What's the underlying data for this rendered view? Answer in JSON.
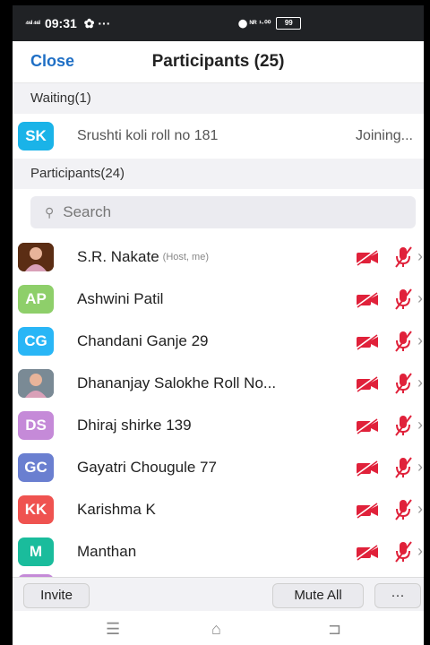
{
  "status_bar": {
    "signal": "⁴⁶ᴵ ⁴⁶ᴵ",
    "time": "09:31",
    "icons": "✿ ···",
    "right_icons": "⬤ ᴺᴿ ¹·⁰⁰",
    "battery": "99"
  },
  "header": {
    "close_label": "Close",
    "title": "Participants (25)"
  },
  "waiting": {
    "section_label": "Waiting(1)",
    "item": {
      "initials": "SK",
      "name": "Srushti koli roll no 181",
      "status": "Joining...",
      "color": "#1ab3e8"
    }
  },
  "participants": {
    "section_label": "Participants(24)",
    "search_placeholder": "Search",
    "items": [
      {
        "initials": "",
        "name": "S.R. Nakate",
        "tag": "(Host, me)",
        "color": "#5b2d14",
        "photo": true
      },
      {
        "initials": "AP",
        "name": "Ashwini Patil",
        "tag": "",
        "color": "#8ecf6a"
      },
      {
        "initials": "CG",
        "name": "Chandani Ganje 29",
        "tag": "",
        "color": "#29b6f6"
      },
      {
        "initials": "",
        "name": "Dhananjay Salokhe Roll No...",
        "tag": "",
        "color": "#7a8a95",
        "photo": true
      },
      {
        "initials": "DS",
        "name": "Dhiraj shirke 139",
        "tag": "",
        "color": "#c58ad8"
      },
      {
        "initials": "GC",
        "name": "Gayatri Chougule 77",
        "tag": "",
        "color": "#6a7fd0"
      },
      {
        "initials": "KK",
        "name": "Karishma K",
        "tag": "",
        "color": "#ef5350"
      },
      {
        "initials": "M",
        "name": "Manthan",
        "tag": "",
        "color": "#1abc9c"
      }
    ]
  },
  "bottom_bar": {
    "invite_label": "Invite",
    "mute_all_label": "Mute All",
    "more_label": "···"
  },
  "nav_bar": {
    "menu_icon": "☰",
    "home_icon": "⌂",
    "back_icon": "⊐"
  },
  "colors": {
    "accent": "#1f6fc5",
    "muted_icon": "#e0213a"
  }
}
